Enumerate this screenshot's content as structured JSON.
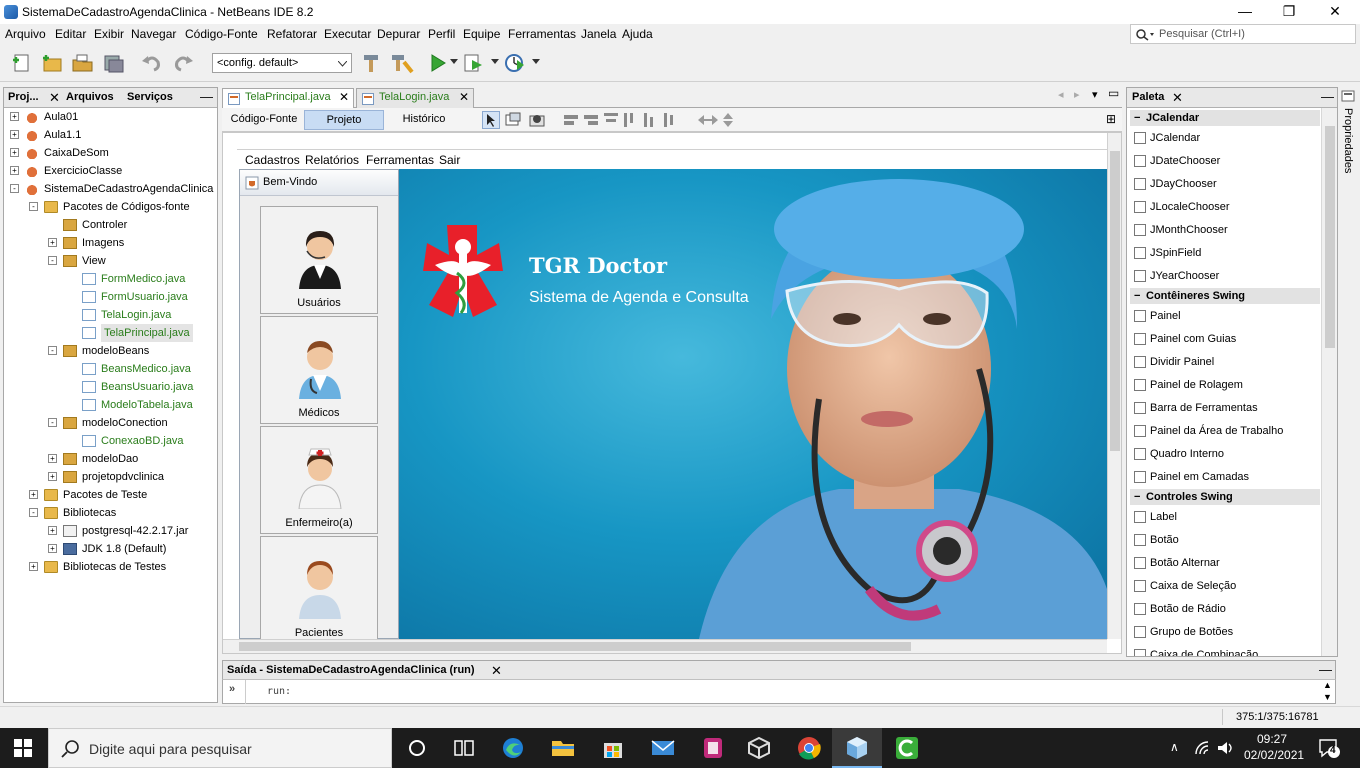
{
  "window": {
    "title": "SistemaDeCadastroAgendaClinica - NetBeans IDE 8.2",
    "minimize": "—",
    "maximize": "❐",
    "close": "✕"
  },
  "menu": [
    "Arquivo",
    "Editar",
    "Exibir",
    "Navegar",
    "Código-Fonte",
    "Refatorar",
    "Executar",
    "Depurar",
    "Perfil",
    "Equipe",
    "Ferramentas",
    "Janela",
    "Ajuda"
  ],
  "search": {
    "placeholder": "Pesquisar (Ctrl+I)"
  },
  "toolbar": {
    "config": "<config. default>"
  },
  "left_tabs": [
    "Proj...",
    "Arquivos",
    "Serviços"
  ],
  "tree": [
    {
      "label": "Aula01",
      "icon": "project"
    },
    {
      "label": "Aula1.1",
      "icon": "project"
    },
    {
      "label": "CaixaDeSom",
      "icon": "project"
    },
    {
      "label": "ExercicioClasse",
      "icon": "project"
    },
    {
      "label": "SistemaDeCadastroAgendaClinica",
      "icon": "project"
    },
    {
      "label": "Pacotes de Códigos-fonte",
      "icon": "folder"
    },
    {
      "label": "Controler",
      "icon": "package"
    },
    {
      "label": "Imagens",
      "icon": "package"
    },
    {
      "label": "View",
      "icon": "package"
    },
    {
      "label": "FormMedico.java",
      "icon": "java"
    },
    {
      "label": "FormUsuario.java",
      "icon": "java"
    },
    {
      "label": "TelaLogin.java",
      "icon": "java"
    },
    {
      "label": "TelaPrincipal.java",
      "icon": "java"
    },
    {
      "label": "modeloBeans",
      "icon": "package"
    },
    {
      "label": "BeansMedico.java",
      "icon": "java"
    },
    {
      "label": "BeansUsuario.java",
      "icon": "java"
    },
    {
      "label": "ModeloTabela.java",
      "icon": "java"
    },
    {
      "label": "modeloConection",
      "icon": "package"
    },
    {
      "label": "ConexaoBD.java",
      "icon": "java"
    },
    {
      "label": "modeloDao",
      "icon": "package"
    },
    {
      "label": "projetopdvclinica",
      "icon": "package"
    },
    {
      "label": "Pacotes de Teste",
      "icon": "folder"
    },
    {
      "label": "Bibliotecas",
      "icon": "folder"
    },
    {
      "label": "postgresql-42.2.17.jar",
      "icon": "jar"
    },
    {
      "label": "JDK 1.8 (Default)",
      "icon": "jdk"
    },
    {
      "label": "Bibliotecas de Testes",
      "icon": "folder"
    }
  ],
  "editor_tabs": [
    "TelaPrincipal.java",
    "TelaLogin.java"
  ],
  "view_tabs": [
    "Código-Fonte",
    "Projeto",
    "Histórico"
  ],
  "form_menu": [
    "Cadastros",
    "Relatórios",
    "Ferramentas",
    "Sair"
  ],
  "internal_frame": {
    "title": "Bem-Vindo",
    "buttons": [
      "Usuários",
      "Médicos",
      "Enfermeiro(a)",
      "Pacientes"
    ]
  },
  "brand": {
    "title": "TGR Doctor",
    "subtitle": "Sistema de Agenda e Consulta"
  },
  "palette": {
    "tab": "Paleta",
    "categories": [
      {
        "name": "JCalendar",
        "items": [
          "JCalendar",
          "JDateChooser",
          "JDayChooser",
          "JLocaleChooser",
          "JMonthChooser",
          "JSpinField",
          "JYearChooser"
        ]
      },
      {
        "name": "Contêineres Swing",
        "items": [
          "Painel",
          "Painel com Guias",
          "Dividir Painel",
          "Painel de Rolagem",
          "Barra de Ferramentas",
          "Painel da Área de Trabalho",
          "Quadro Interno",
          "Painel em Camadas"
        ]
      },
      {
        "name": "Controles Swing",
        "items": [
          "Label",
          "Botão",
          "Botão Alternar",
          "Caixa de Seleção",
          "Botão de Rádio",
          "Grupo de Botões",
          "Caixa de Combinação"
        ]
      }
    ]
  },
  "properties_tab": "Propriedades",
  "output": {
    "tab": "Saída - SistemaDeCadastroAgendaClinica (run)",
    "line": "run:"
  },
  "status": {
    "position": "375:1/375:16781"
  },
  "taskbar": {
    "search_placeholder": "Digite aqui para pesquisar",
    "time": "09:27",
    "date": "02/02/2021",
    "notifications": "4"
  }
}
